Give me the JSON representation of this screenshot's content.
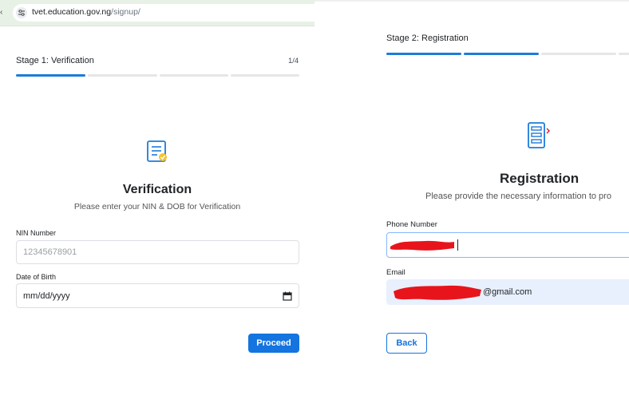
{
  "browser": {
    "url_host": "tvet.education.gov.ng",
    "url_path": "/signup/"
  },
  "verification": {
    "stage_title": "Stage 1: Verification",
    "stage_count": "1/4",
    "progress": {
      "segments": 4,
      "active": 1
    },
    "heading": "Verification",
    "subtitle": "Please enter your NIN & DOB for Verification",
    "nin_label": "NIN Number",
    "nin_placeholder": "12345678901",
    "nin_value": "",
    "dob_label": "Date of Birth",
    "dob_value": "mm/dd/yyyy",
    "proceed_label": "Proceed"
  },
  "registration": {
    "stage_title": "Stage 2: Registration",
    "progress": {
      "segments": 4,
      "active": 2
    },
    "heading": "Registration",
    "subtitle": "Please provide the necessary information to pro",
    "phone_label": "Phone Number",
    "email_label": "Email",
    "email_visible_suffix": "@gmail.com",
    "back_label": "Back"
  },
  "colors": {
    "primary": "#1474e0",
    "progress_active": "#1e7bd8",
    "progress_inactive": "#e6e6e6",
    "redaction": "#e8141c",
    "autofill": "#e8f0fe"
  },
  "icons": {
    "verification": "checklist-verify-icon",
    "registration": "form-list-icon",
    "calendar": "calendar-icon",
    "site_info": "site-info-icon"
  }
}
